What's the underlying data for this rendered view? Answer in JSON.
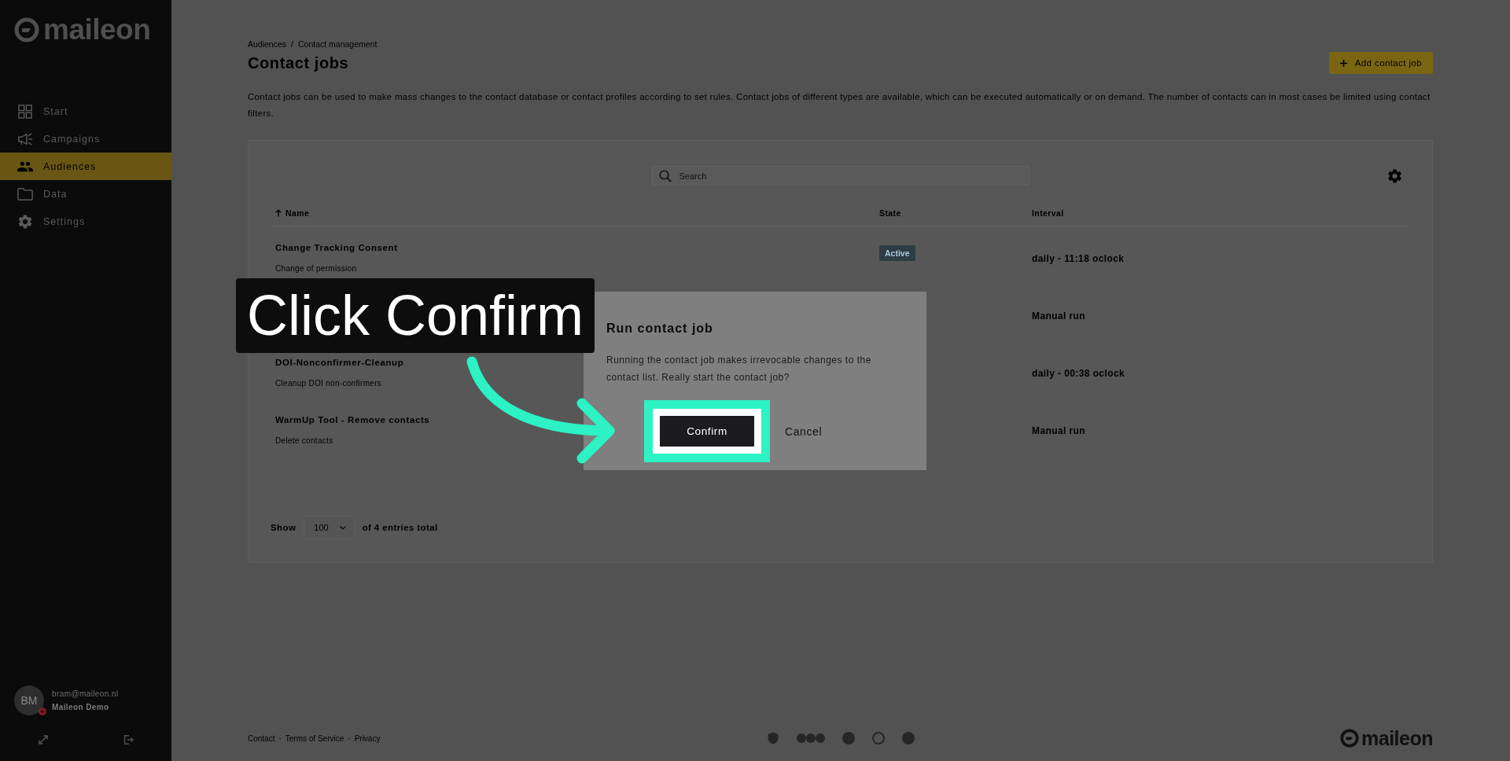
{
  "sidebar": {
    "logo": "maileon",
    "items": [
      {
        "label": "Start",
        "selected": false
      },
      {
        "label": "Campaigns",
        "selected": false
      },
      {
        "label": "Audiences",
        "selected": true
      },
      {
        "label": "Data",
        "selected": false
      },
      {
        "label": "Settings",
        "selected": false
      }
    ],
    "user": {
      "initials": "BM",
      "email": "bram@maileon.nl",
      "name": "Maileon Demo"
    }
  },
  "header": {
    "breadcrumb": {
      "items": [
        "Audiences",
        "Contact management"
      ],
      "separator": "/"
    },
    "title": "Contact jobs",
    "add_button": "Add contact job",
    "description": "Contact jobs can be used to make mass changes to the contact database or contact profiles according to set rules. Contact jobs of different types are available, which can be executed automatically or on demand. The number of contacts can in most cases be limited using contact filters."
  },
  "table": {
    "search": {
      "placeholder": "Search"
    },
    "columns": [
      {
        "label": "Name",
        "sorted": true
      },
      {
        "label": "State",
        "sorted": false
      },
      {
        "label": "Interval",
        "sorted": false
      }
    ],
    "rows": [
      {
        "name": "Change Tracking Consent",
        "description": "Change of permission",
        "state": {
          "label": "Active",
          "color": "#2e3c43"
        },
        "interval": "daily - 11:18 oclock"
      },
      {
        "interval": "Manual run"
      },
      {
        "name": "DOI-Nonconfirmer-Cleanup",
        "description": "Cleanup DOI non-confirmers",
        "interval": "daily - 00:38 oclock"
      },
      {
        "name": "WarmUp Tool - Remove contacts",
        "description": "Delete contacts",
        "interval": "Manual run"
      }
    ],
    "pager": {
      "show_label": "Show",
      "page_size": "100",
      "total": "of 4 entries total"
    }
  },
  "footer": {
    "links": [
      "Contact",
      "Terms of Service",
      "Privacy"
    ],
    "separator": "·",
    "logo": "maileon"
  },
  "modal": {
    "title": "Run contact job",
    "message": "Running the contact job makes irrevocable changes to the contact list. Really start the contact job?",
    "buttons": [
      {
        "label": "Confirm",
        "kind": "primary",
        "highlighted": true
      },
      {
        "label": "Cancel",
        "kind": "text",
        "highlighted": false
      }
    ]
  },
  "annotation": {
    "text": "Click Confirm"
  }
}
